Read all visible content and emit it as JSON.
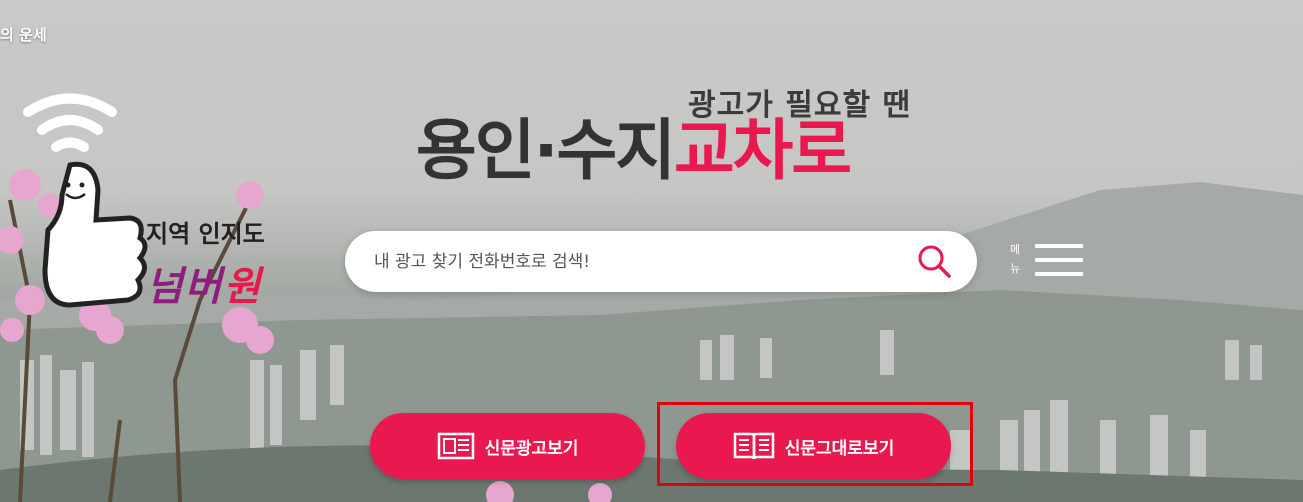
{
  "top_bar": {
    "fortune_text": "의 운세"
  },
  "mascot": {
    "line1": "지역 인지도",
    "line2_a": "넘버",
    "line2_b": "원"
  },
  "brand": {
    "slogan": "광고가 필요할 땐",
    "name_dark": "용인·수지",
    "name_red": "교차로"
  },
  "search": {
    "placeholder": "내 광고 찾기 전화번호로 검색!"
  },
  "menu": {
    "label_line1": "메",
    "label_line2": "뉴"
  },
  "buttons": {
    "newspaper_ad": "신문광고보기",
    "newspaper_view": "신문그대로보기"
  },
  "colors": {
    "accent": "#e9184f",
    "highlight_box": "#e0000f"
  }
}
